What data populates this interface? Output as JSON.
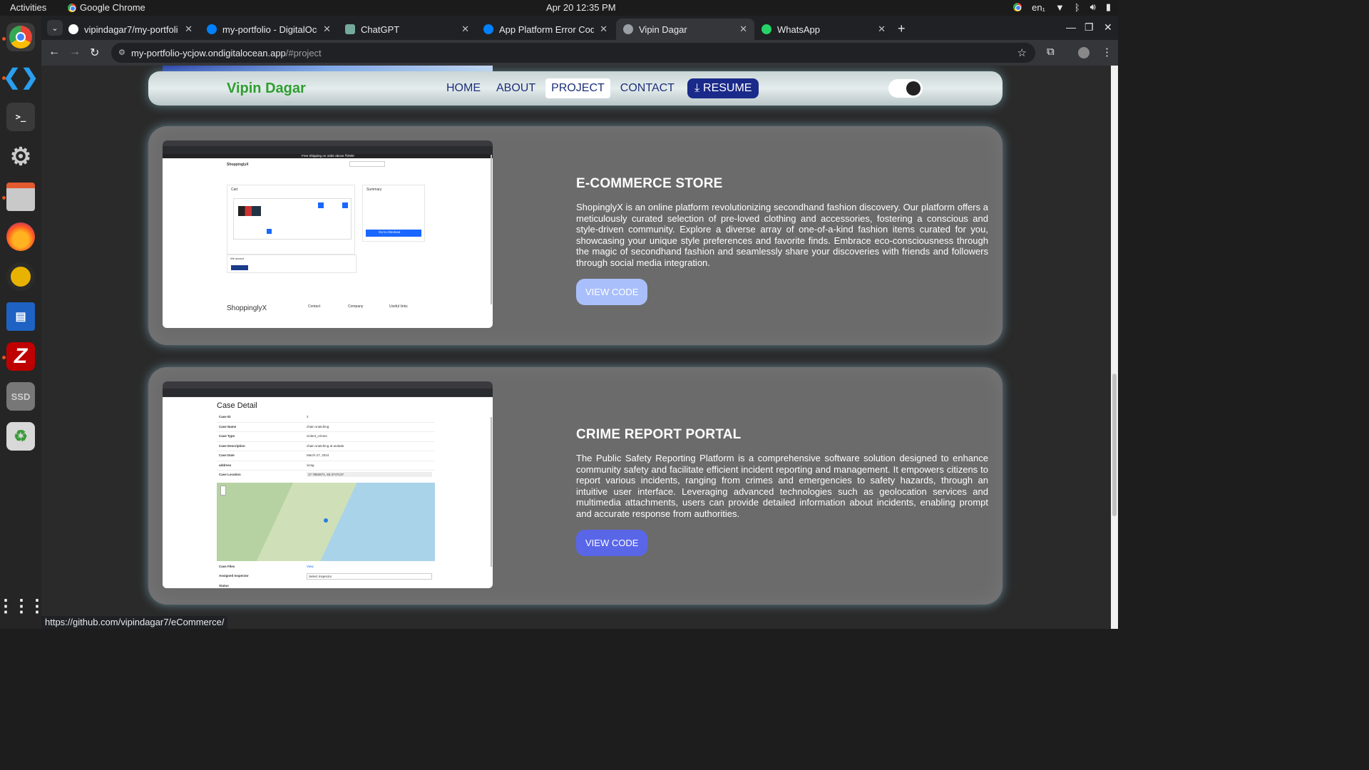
{
  "topbar": {
    "activities": "Activities",
    "app": "Google Chrome",
    "clock": "Apr 20  12:35 PM",
    "lang": "en₁"
  },
  "tabs": [
    {
      "title": "vipindagar7/my-portfoli",
      "icon": "github-icon",
      "color": "#ffffff"
    },
    {
      "title": "my-portfolio - DigitalOce",
      "icon": "digitalocean-icon",
      "color": "#0080ff"
    },
    {
      "title": "ChatGPT",
      "icon": "chatgpt-icon",
      "color": "#74aa9c"
    },
    {
      "title": "App Platform Error Code",
      "icon": "digitalocean-icon",
      "color": "#0080ff"
    },
    {
      "title": "Vipin Dagar",
      "icon": "globe-icon",
      "color": "#9aa0a6"
    },
    {
      "title": "WhatsApp",
      "icon": "whatsapp-icon",
      "color": "#25d366"
    }
  ],
  "address": {
    "host": "my-portfolio-ycjow.ondigitalocean.app",
    "path": "/#project"
  },
  "site": {
    "brand": "Vipin Dagar",
    "nav": [
      "HOME",
      "ABOUT",
      "PROJECT",
      "CONTACT"
    ],
    "resume": "RESUME"
  },
  "projects": [
    {
      "title": "E-COMMERCE STORE",
      "description": "ShopinglyX is an online platform revolutionizing secondhand fashion discovery. Our platform offers a meticulously curated selection of pre-loved clothing and accessories, fostering a conscious and style-driven community. Explore a diverse array of one-of-a-kind fashion items curated for you, showcasing your unique style preferences and favorite finds. Embrace eco-consciousness through the magic of secondhand fashion and seamlessly share your discoveries with friends and followers through social media integration.",
      "button": "VIEW CODE",
      "shot": {
        "banner": "Free Shipping on order above ₹2000",
        "logo": "ShoppinglyX",
        "cart": "Cart",
        "summary": "Summary",
        "checkout": "Go to checkout",
        "footer_brand": "ShoppinglyX",
        "footer_cols": [
          "Contact",
          "Company",
          "Useful links"
        ],
        "we_accept": "We accept"
      }
    },
    {
      "title": "CRIME REPORT PORTAL",
      "description": "The Public Safety Reporting Platform is a comprehensive software solution designed to enhance community safety and facilitate efficient incident reporting and management. It empowers citizens to report various incidents, ranging from crimes and emergencies to safety hazards, through an intuitive user interface. Leveraging advanced technologies such as geolocation services and multimedia attachments, users can provide detailed information about incidents, enabling prompt and accurate response from authorities.",
      "button": "VIEW CODE",
      "shot": {
        "heading": "Case Detail",
        "rows": [
          {
            "k": "Case ID",
            "v": "2"
          },
          {
            "k": "Case Name",
            "v": "chain snatching"
          },
          {
            "k": "Case Type",
            "v": "violent_crimes"
          },
          {
            "k": "Case Description",
            "v": "chain snatching at andade"
          },
          {
            "k": "Case Date",
            "v": "March 27, 2024"
          },
          {
            "k": "address",
            "v": "vizag"
          },
          {
            "k": "Case Location",
            "v": "17.7862671, 83.3747137"
          }
        ],
        "files": "Case Files",
        "view": "View",
        "inspector": "Assigned Inspector",
        "select": "Select Inspector",
        "status": "Status"
      }
    }
  ],
  "status_url": "https://github.com/vipindagar7/eCommerce/"
}
